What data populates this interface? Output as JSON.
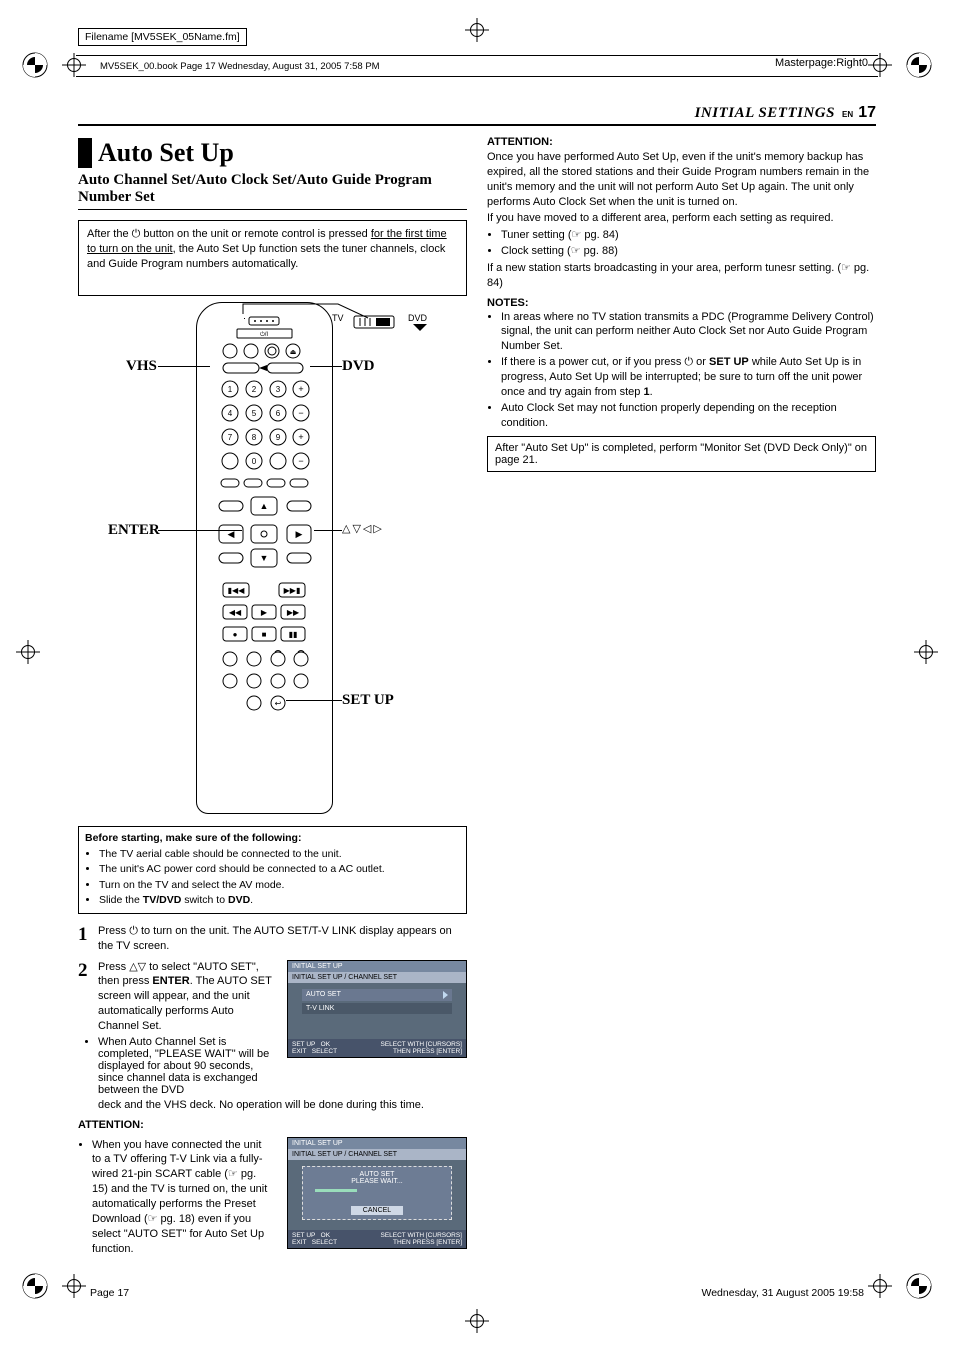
{
  "meta": {
    "filename": "Filename [MV5SEK_05Name.fm]",
    "bookline": "MV5SEK_00.book  Page 17  Wednesday, August 31, 2005  7:58 PM",
    "masterpage": "Masterpage:Right0",
    "footer_left": "Page 17",
    "footer_right": "Wednesday, 31 August 2005  19:58"
  },
  "header": {
    "section": "INITIAL SETTINGS",
    "lang": "EN",
    "page": "17"
  },
  "left": {
    "h1": "Auto Set Up",
    "h2": "Auto Channel Set/Auto Clock Set/Auto Guide Program Number Set",
    "intro_a": "After the ",
    "intro_b": " button on the unit or remote control is pressed ",
    "intro_under": "for the first time to turn on the unit",
    "intro_c": ", the Auto Set Up function sets the tuner channels, clock and Guide Program numbers automatically.",
    "remote_labels": {
      "vhs": "VHS",
      "dvd": "DVD",
      "enter": "ENTER",
      "setup": "SET UP",
      "tv": "TV",
      "dvd_small": "DVD",
      "arrows": "△▽◁▷"
    },
    "before": {
      "hd": "Before starting, make sure of the following:",
      "items": [
        "The TV aerial cable should be connected to the unit.",
        "The unit's AC power cord should be connected to a AC outlet.",
        "Turn on the TV and select the AV mode.",
        "Slide the TV/DVD switch to DVD."
      ],
      "tvdvd_bold": "TV/DVD",
      "dvd_bold": "DVD"
    },
    "step1": {
      "n": "1",
      "a": "Press ",
      "b": " to turn on the unit. The AUTO SET/T-V LINK display appears on the TV screen."
    },
    "step2": {
      "n": "2",
      "a": "Press ",
      "arrows": "△▽",
      "b": " to select \"AUTO SET\", then press ",
      "enter": "ENTER",
      "c": ". The AUTO SET screen will appear, and the unit automatically performs Auto Channel Set.",
      "bullet": "When Auto Channel Set is completed, \"PLEASE WAIT\" will be displayed for about 90 seconds, since channel data is exchanged between the DVD deck and the VHS deck. No operation will be done during this time."
    },
    "osd1": {
      "bar1": "INITIAL SET UP",
      "bar2": "INITIAL SET UP / CHANNEL SET",
      "row1": "AUTO SET",
      "row2": "T-V LINK",
      "ftr_l1": "SET UP",
      "ftr_l2": "EXIT",
      "ftr_m1": "OK",
      "ftr_m2": "SELECT",
      "ftr_r1": "SELECT WITH [CURSORS]",
      "ftr_r2": "THEN PRESS [ENTER]"
    },
    "attention_hd": "ATTENTION:",
    "attention_bullet": "When you have connected the unit to a TV offering T-V Link via a fully-wired 21-pin SCART cable (☞ pg. 15) and the TV is turned on, the unit automatically performs the Preset Download (☞ pg. 18) even if you select \"AUTO SET\" for Auto Set Up function.",
    "osd2": {
      "bar1": "INITIAL SET UP",
      "bar2": "INITIAL SET UP / CHANNEL SET",
      "popup_hd": "AUTO SET",
      "popup_txt": "PLEASE WAIT...",
      "popup_btn": "CANCEL",
      "ftr_l1": "SET UP",
      "ftr_l2": "EXIT",
      "ftr_m1": "OK",
      "ftr_m2": "SELECT",
      "ftr_r1": "SELECT WITH [CURSORS]",
      "ftr_r2": "THEN PRESS [ENTER]"
    }
  },
  "right": {
    "attention_hd": "ATTENTION:",
    "att_p1": "Once you have performed Auto Set Up, even if the unit's memory backup has expired, all the stored stations and their Guide Program numbers remain in the unit's memory and the unit will not perform Auto Set Up again. The unit only performs Auto Clock Set when the unit is turned on.",
    "att_p2": "If you have moved to a different area, perform each setting as required.",
    "att_b1": "Tuner setting (☞ pg. 84)",
    "att_b2": "Clock setting (☞ pg. 88)",
    "att_p3": "If a new station starts broadcasting in your area, perform tunesr setting. (☞ pg. 84)",
    "notes_hd": "NOTES:",
    "note1": "In areas where no TV station transmits a PDC (Programme Delivery Control) signal, the unit can perform neither Auto Clock Set nor Auto Guide Program Number Set.",
    "note2_a": "If there is a power cut, or if you press ",
    "note2_b": " or ",
    "note2_setup": "SET UP",
    "note2_c": " while Auto Set Up is in progress, Auto Set Up will be interrupted; be sure to turn off the unit power once and try again from step ",
    "note2_step": "1",
    "note2_d": ".",
    "note3": "Auto Clock Set may not function properly depending on the reception condition.",
    "after_box": "After \"Auto Set Up\" is completed, perform \"Monitor Set (DVD Deck Only)\" on page 21."
  }
}
